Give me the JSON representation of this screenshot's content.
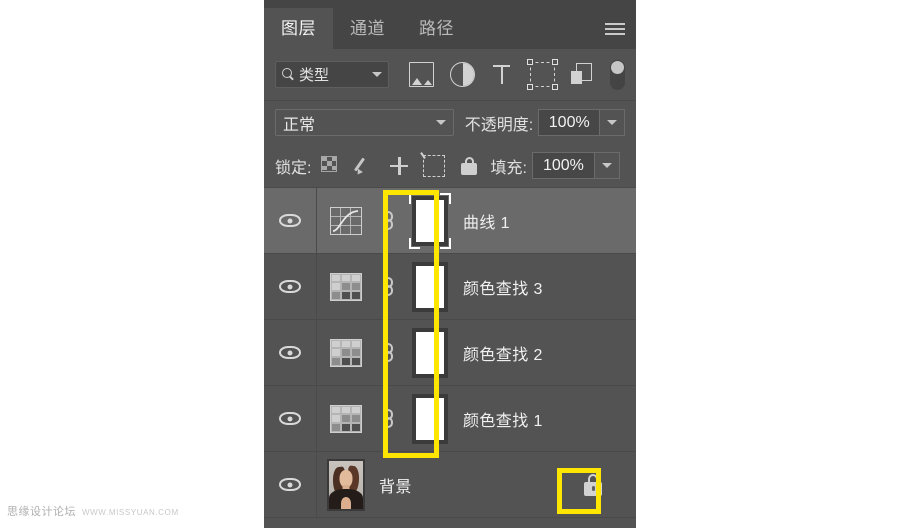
{
  "panel": {
    "tabs": [
      {
        "label": "图层",
        "active": true
      },
      {
        "label": "通道",
        "active": false
      },
      {
        "label": "路径",
        "active": false
      }
    ],
    "menu_icon": "hamburger-menu-icon"
  },
  "filter_row": {
    "search_icon": "search-icon",
    "filter_type": "类型",
    "dropdown_icon": "chevron-down-icon",
    "icons": [
      "image-filter-icon",
      "adjustment-filter-icon",
      "type-filter-icon",
      "shape-filter-icon",
      "smart-object-filter-icon"
    ],
    "toggle": "filter-enable-toggle"
  },
  "blend_row": {
    "blend_mode": "正常",
    "blend_dropdown_icon": "chevron-down-icon",
    "opacity_label": "不透明度:",
    "opacity_value": "100%",
    "opacity_stepper_icon": "chevron-down-icon"
  },
  "lock_row": {
    "lock_label": "锁定:",
    "icons": [
      "lock-transparent-pixels-icon",
      "lock-image-pixels-icon",
      "lock-position-icon",
      "lock-artboard-nesting-icon",
      "lock-all-icon"
    ],
    "fill_label": "填充:",
    "fill_value": "100%",
    "fill_stepper_icon": "chevron-down-icon"
  },
  "layers": [
    {
      "name": "曲线 1",
      "visible": true,
      "selected": true,
      "thumb_icon": "curves-adjustment-icon",
      "link_icon": "link-mask-icon",
      "mask": "layer-mask-thumbnail",
      "mask_selected": true
    },
    {
      "name": "颜色查找 3",
      "visible": true,
      "selected": false,
      "thumb_icon": "color-lookup-adjustment-icon",
      "link_icon": "link-mask-icon",
      "mask": "layer-mask-thumbnail",
      "mask_selected": false
    },
    {
      "name": "颜色查找 2",
      "visible": true,
      "selected": false,
      "thumb_icon": "color-lookup-adjustment-icon",
      "link_icon": "link-mask-icon",
      "mask": "layer-mask-thumbnail",
      "mask_selected": false
    },
    {
      "name": "颜色查找 1",
      "visible": true,
      "selected": false,
      "thumb_icon": "color-lookup-adjustment-icon",
      "link_icon": "link-mask-icon",
      "mask": "layer-mask-thumbnail",
      "mask_selected": false
    },
    {
      "name": "背景",
      "visible": true,
      "selected": false,
      "thumb_icon": "portrait-photo-thumbnail",
      "lock_badge": "locked-layer-icon"
    }
  ],
  "annotations": {
    "mask_highlight": "mask-thumbnails-highlight-box",
    "lock_highlight": "background-lock-highlight-box",
    "highlight_color": "#ffe600"
  },
  "watermark": {
    "name": "思缘设计论坛",
    "url": "WWW.MISSYUAN.COM"
  }
}
